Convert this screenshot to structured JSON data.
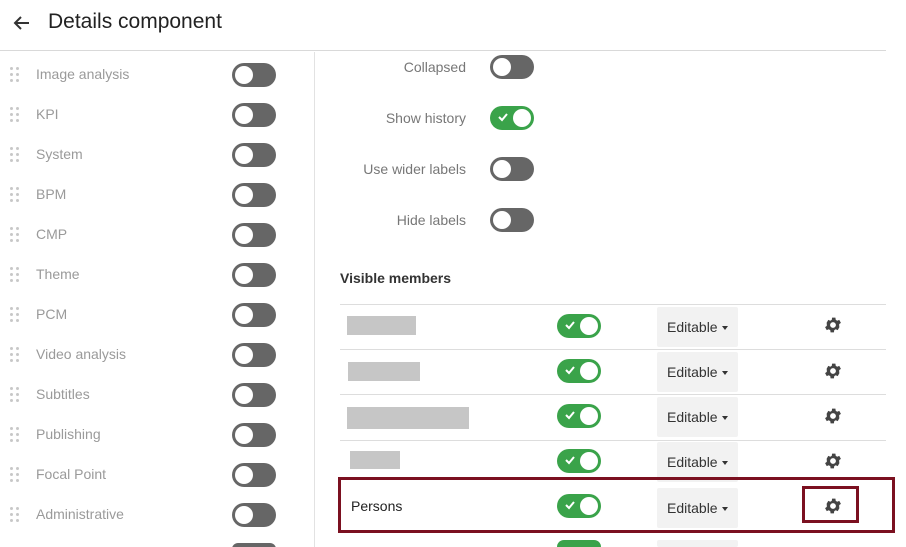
{
  "header": {
    "title": "Details component",
    "back_icon": "arrow-left-icon"
  },
  "sidebar": {
    "items": [
      {
        "label": "Image analysis",
        "enabled": false
      },
      {
        "label": "KPI",
        "enabled": false
      },
      {
        "label": "System",
        "enabled": false
      },
      {
        "label": "BPM",
        "enabled": false
      },
      {
        "label": "CMP",
        "enabled": false
      },
      {
        "label": "Theme",
        "enabled": false
      },
      {
        "label": "PCM",
        "enabled": false
      },
      {
        "label": "Video analysis",
        "enabled": false
      },
      {
        "label": "Subtitles",
        "enabled": false
      },
      {
        "label": "Publishing",
        "enabled": false
      },
      {
        "label": "Focal Point",
        "enabled": false
      },
      {
        "label": "Administrative",
        "enabled": false
      }
    ]
  },
  "settings": {
    "collapsed": {
      "label": "Collapsed",
      "enabled": false
    },
    "show_history": {
      "label": "Show history",
      "enabled": true
    },
    "use_wider_labels": {
      "label": "Use wider labels",
      "enabled": false
    },
    "hide_labels": {
      "label": "Hide labels",
      "enabled": false
    }
  },
  "visible_members": {
    "title": "Visible members",
    "rows": [
      {
        "name": "",
        "redacted": true,
        "enabled": true,
        "permission": "Editable"
      },
      {
        "name": "",
        "redacted": true,
        "enabled": true,
        "permission": "Editable"
      },
      {
        "name": "",
        "redacted": true,
        "enabled": true,
        "permission": "Editable"
      },
      {
        "name": "",
        "redacted": true,
        "enabled": true,
        "permission": "Editable"
      },
      {
        "name": "Persons",
        "redacted": false,
        "enabled": true,
        "permission": "Editable",
        "highlighted": true
      }
    ]
  },
  "colors": {
    "toggle_on": "#3aa34a",
    "toggle_off": "#666666",
    "highlight": "#7b1020"
  }
}
